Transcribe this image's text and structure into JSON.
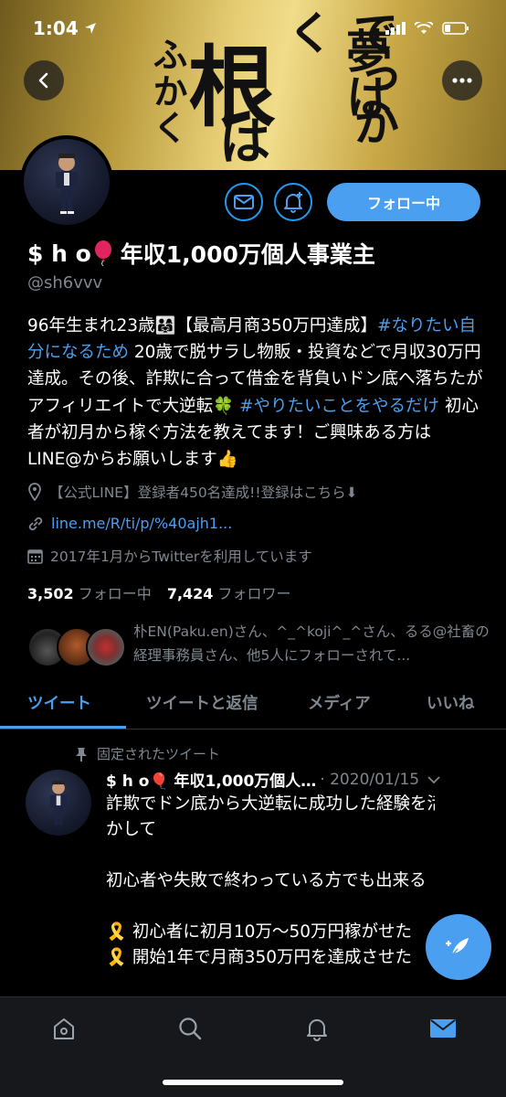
{
  "status_bar": {
    "time": "1:04",
    "location_icon": "location-arrow-icon",
    "signal_icon": "signal-bars-icon",
    "wifi_icon": "wifi-icon",
    "battery_icon": "battery-icon"
  },
  "banner": {
    "art_text": [
      "ふかく",
      "根",
      "は",
      "でっかく",
      "夢は"
    ]
  },
  "header": {
    "back_icon": "back-arrow-icon",
    "more_icon": "more-dots-icon"
  },
  "profile": {
    "name_prefix": "$ h o",
    "name_suffix": "年収1,000万個人事業主",
    "handle": "@sh6vvv",
    "bio_parts": [
      {
        "text": "96年生まれ23歳👨‍👩‍👧【最高月商350万円達成】",
        "hashtag": false
      },
      {
        "text": "#なりたい自分になるため",
        "hashtag": true
      },
      {
        "text": " 20歳で脱サラし物販・投資などで月収30万円達成。その後、詐欺に合って借金を背負いドン底へ落ちたがアフィリエイトで大逆転🍀 ",
        "hashtag": false
      },
      {
        "text": "#やりたいことをやるだけ",
        "hashtag": true
      },
      {
        "text": " 初心者が初月から稼ぐ方法を教えてます！ご興味ある方はLINE@からお願いします👍",
        "hashtag": false
      }
    ],
    "location": "【公式LINE】登録者450名達成!!登録はこちら⬇",
    "link": "line.me/R/ti/p/%40ajh1...",
    "joined": "2017年1月からTwitterを利用しています",
    "following_count": "3,502",
    "following_label": "フォロー中",
    "followers_count": "7,424",
    "followers_label": "フォロワー",
    "followed_by": "朴EN(Paku.en)さん、^_^koji^_^さん、るる@社畜の経理事務員さん、他5人にフォローされて..."
  },
  "actions": {
    "mail_icon": "envelope-icon",
    "bell_icon": "bell-plus-icon",
    "follow_label": "フォロー中"
  },
  "tabs": [
    {
      "label": "ツイート",
      "active": true
    },
    {
      "label": "ツイートと返信",
      "active": false
    },
    {
      "label": "メディア",
      "active": false
    },
    {
      "label": "いいね",
      "active": false
    }
  ],
  "tweet": {
    "pinned_label": "固定されたツイート",
    "author": "$ h o🎈 年収1,000万個人…",
    "date": "· 2020/01/15",
    "lines": [
      "詐欺でドン底から大逆転に成功した経験を活",
      "かして",
      "",
      "初心者や失敗で終わっている方でも出来る",
      "",
      "🎗️ 初心者に初月10万〜50万円稼がせた",
      "🎗️ 開始1年で月商350万円を達成させた"
    ]
  },
  "bottom_nav": [
    "home-icon",
    "search-icon",
    "notifications-icon",
    "messages-icon"
  ],
  "colors": {
    "accent": "#4a9ff0",
    "muted": "#7f8790",
    "background": "#000000"
  }
}
